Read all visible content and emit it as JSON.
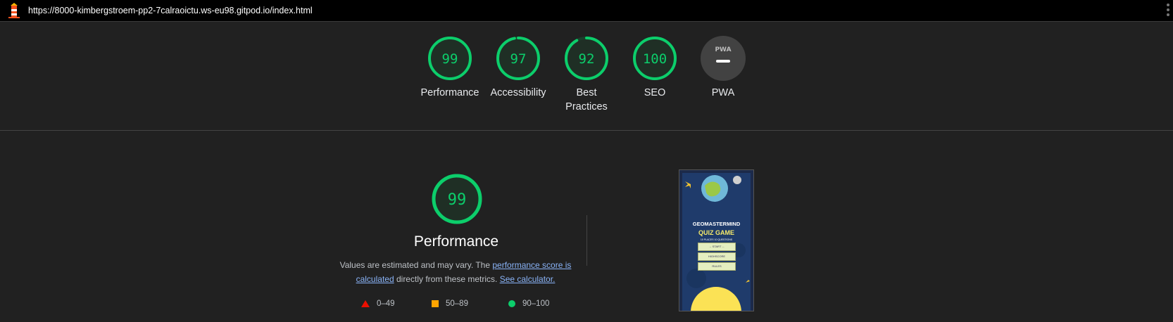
{
  "header": {
    "url": "https://8000-kimbergstroem-pp2-7calraoictu.ws-eu98.gitpod.io/index.html"
  },
  "gauges": [
    {
      "label": "Performance",
      "score": "99",
      "value": 99
    },
    {
      "label": "Accessibility",
      "score": "97",
      "value": 97
    },
    {
      "label": "Best Practices",
      "score": "92",
      "value": 92
    },
    {
      "label": "SEO",
      "score": "100",
      "value": 100
    },
    {
      "label": "PWA",
      "score": "",
      "value": null
    }
  ],
  "pwa_badge": {
    "text": "PWA"
  },
  "performance": {
    "score": "99",
    "value": 99,
    "title": "Performance",
    "desc_prefix": "Values are estimated and may vary. The ",
    "desc_link1": "performance score is calculated",
    "desc_middle": " directly from these metrics. ",
    "desc_link2": "See calculator."
  },
  "legend": [
    {
      "range": "0–49",
      "color": "#eb0f00"
    },
    {
      "range": "50–89",
      "color": "#ffa400"
    },
    {
      "range": "90–100",
      "color": "#0cce6b"
    }
  ],
  "screenshot": {
    "title": "GEOMASTERMIND",
    "subtitle": "QUIZ GAME",
    "tagline": "10 PLACES 10 QUESTIONS",
    "buttons": [
      "→ START ←",
      "HIGHSCORE",
      "RULES"
    ]
  },
  "colors": {
    "pass": "#0cce6b",
    "pass_bg": "#1f2f25",
    "pwa_bg": "#424242"
  }
}
